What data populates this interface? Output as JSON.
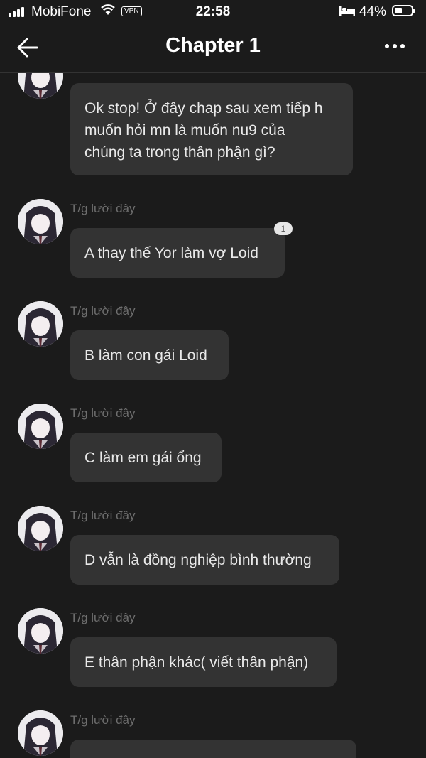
{
  "status_bar": {
    "carrier": "MobiFone",
    "vpn": "VPN",
    "time": "22:58",
    "battery_percent": "44%",
    "battery_level": 0.44
  },
  "header": {
    "title": "Chapter 1"
  },
  "messages": [
    {
      "author": "",
      "text_lines": [
        "Ok stop! Ở đây chap sau xem tiếp h",
        "muốn hỏi mn là muốn nu9 của",
        "chúng ta trong thân phận gì?"
      ]
    },
    {
      "author": "T/g lười đây",
      "text": "A thay thế Yor làm vợ Loid",
      "reaction_count": "1"
    },
    {
      "author": "T/g lười đây",
      "text": "B làm con gái Loid"
    },
    {
      "author": "T/g lười đây",
      "text": "C làm em gái ổng"
    },
    {
      "author": "T/g lười đây",
      "text": "D vẫn là đồng nghiệp bình thường"
    },
    {
      "author": "T/g lười đây",
      "text": "E thân phận khác( viết thân phận)"
    },
    {
      "author": "T/g lười đây",
      "text": ""
    }
  ]
}
